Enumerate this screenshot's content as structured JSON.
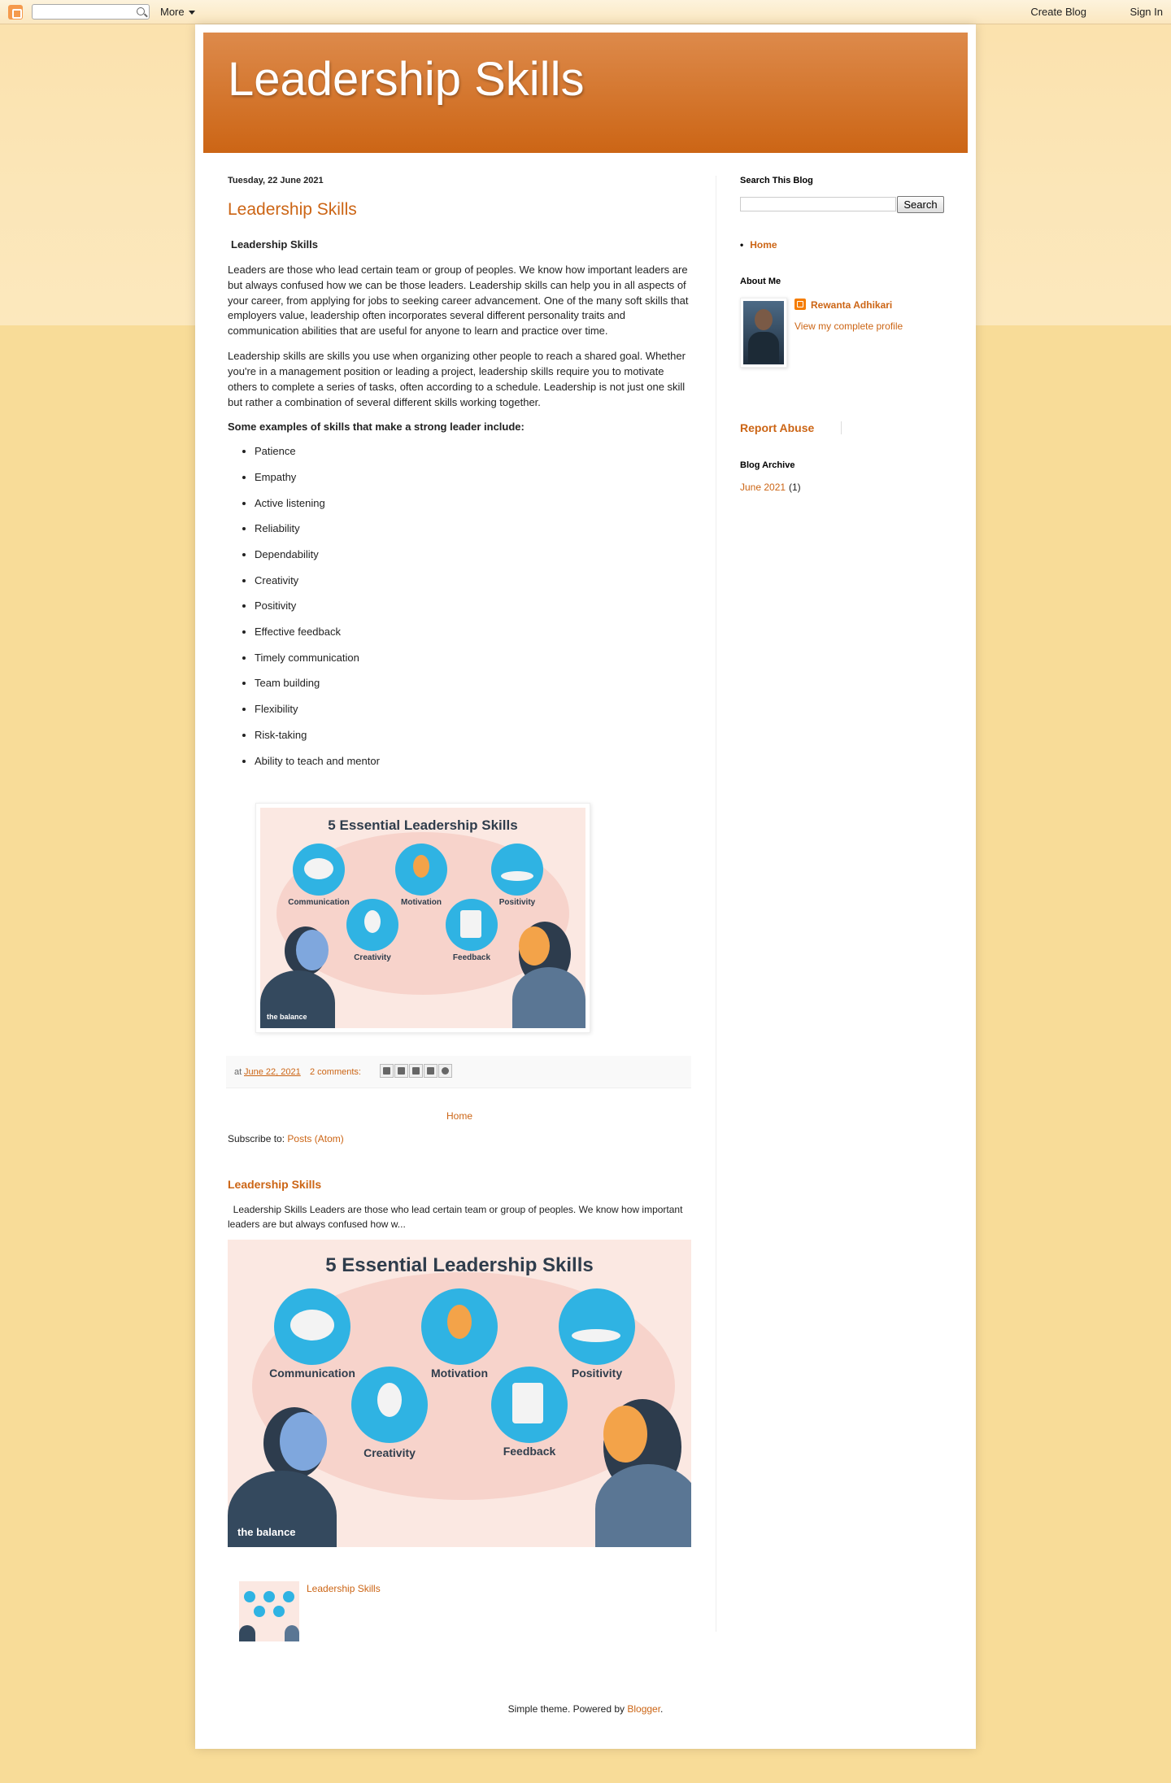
{
  "navbar": {
    "more_label": "More",
    "create_blog": "Create Blog",
    "sign_in": "Sign In"
  },
  "header": {
    "title": "Leadership Skills"
  },
  "post": {
    "date": "Tuesday, 22 June 2021",
    "title": "Leadership Skills",
    "subhead": "Leadership Skills",
    "paragraph1": "Leaders are those who lead certain team or group of peoples. We know how important leaders are but always confused how we can be those leaders. Leadership skills can help you in all aspects of your career, from applying for jobs to seeking career advancement. One of the many soft skills that employers value, leadership often incorporates several different personality traits and communication abilities that are useful for anyone to learn and practice over time.",
    "paragraph2": "Leadership skills are skills you use when organizing other people to reach a shared goal. Whether you're in a management position or leading a project, leadership skills require you to motivate others to complete a series of tasks, often according to a schedule. Leadership is not just one skill but rather a combination of several different skills working together.",
    "examples_heading": "Some examples of skills that make a strong leader include:",
    "skills": [
      "Patience",
      "Empathy",
      "Active listening",
      "Reliability",
      "Dependability",
      "Creativity",
      "Positivity",
      "Effective feedback",
      "Timely communication",
      "Team building",
      "Flexibility",
      "Risk-taking",
      "Ability to teach and mentor"
    ],
    "footer": {
      "at": "at",
      "date_link": "June 22, 2021",
      "comments": "2 comments:"
    }
  },
  "infographic": {
    "title": "5 Essential Leadership Skills",
    "labels": [
      "Communication",
      "Motivation",
      "Positivity",
      "Creativity",
      "Feedback"
    ],
    "brand": "the balance",
    "accent_color": "#2fb3e3"
  },
  "nav": {
    "home": "Home",
    "subscribe_label": "Subscribe to:",
    "subscribe_link": "Posts (Atom)"
  },
  "popular": {
    "title": "Leadership Skills",
    "snippet": "  Leadership Skills Leaders are those who lead certain team or group of peoples. We know how important leaders are but always confused how w...",
    "thumb_link": "Leadership Skills"
  },
  "sidebar": {
    "search_heading": "Search This Blog",
    "search_button": "Search",
    "home_link": "Home",
    "about_heading": "About Me",
    "author_name": "Rewanta Adhikari",
    "profile_link": "View my complete profile",
    "report_abuse": "Report Abuse",
    "archive_heading": "Blog Archive",
    "archive_link": "June 2021",
    "archive_count": "(1)"
  },
  "footer": {
    "text": "Simple theme. Powered by ",
    "link": "Blogger",
    "end": "."
  },
  "colors": {
    "accent": "#cc6515",
    "header_top": "#dd8a4b",
    "header_bottom": "#cc6515",
    "background": "#f8dc98"
  }
}
